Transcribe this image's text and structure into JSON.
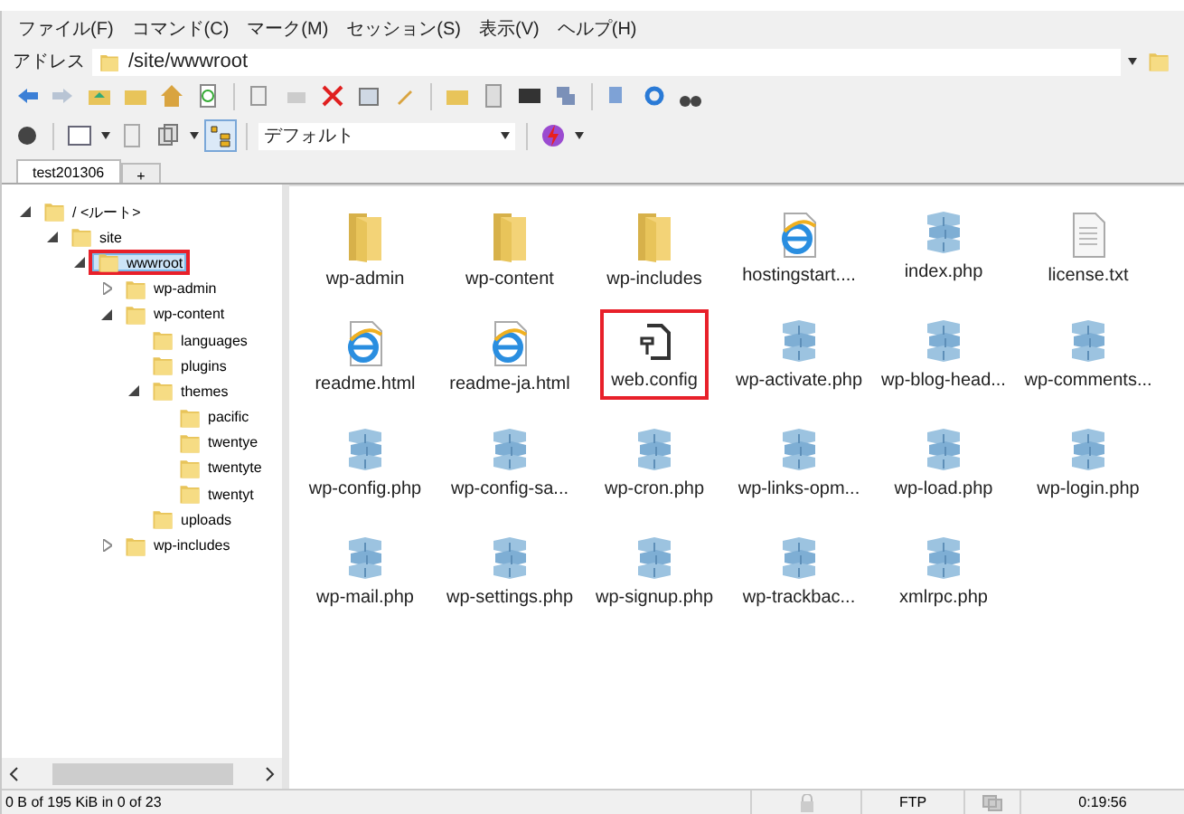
{
  "menu": [
    "ファイル(F)",
    "コマンド(C)",
    "マーク(M)",
    "セッション(S)",
    "表示(V)",
    "ヘルプ(H)"
  ],
  "address": {
    "label": "アドレス",
    "value": "/site/wwwroot"
  },
  "toolbar": {
    "preset": "デフォルト"
  },
  "tabs": [
    {
      "label": "test201306",
      "selected": true
    },
    {
      "label": "+",
      "selected": false
    }
  ],
  "tree": [
    {
      "label": "/ <ルート>",
      "expanded": true,
      "highlighted": false,
      "children": [
        {
          "label": "site",
          "expanded": true,
          "highlighted": false,
          "children": [
            {
              "label": "wwwroot",
              "expanded": true,
              "selected": true,
              "highlighted": true,
              "children": [
                {
                  "label": "wp-admin",
                  "expanded": false,
                  "has_children": true,
                  "highlighted": false
                },
                {
                  "label": "wp-content",
                  "expanded": true,
                  "highlighted": false,
                  "children": [
                    {
                      "label": "languages",
                      "highlighted": false
                    },
                    {
                      "label": "plugins",
                      "highlighted": false
                    },
                    {
                      "label": "themes",
                      "expanded": true,
                      "highlighted": false,
                      "children": [
                        {
                          "label": "pacific",
                          "highlighted": false
                        },
                        {
                          "label": "twentye",
                          "highlighted": false
                        },
                        {
                          "label": "twentyte",
                          "highlighted": false
                        },
                        {
                          "label": "twentyt",
                          "highlighted": false
                        }
                      ]
                    },
                    {
                      "label": "uploads",
                      "highlighted": false
                    }
                  ]
                },
                {
                  "label": "wp-includes",
                  "expanded": false,
                  "has_children": true,
                  "highlighted": false
                }
              ]
            }
          ]
        }
      ]
    }
  ],
  "files": [
    {
      "name": "wp-admin",
      "kind": "folder",
      "highlighted": false
    },
    {
      "name": "wp-content",
      "kind": "folder",
      "highlighted": false
    },
    {
      "name": "wp-includes",
      "kind": "folder",
      "highlighted": false
    },
    {
      "name": "hostingstart....",
      "kind": "web",
      "highlighted": false
    },
    {
      "name": "index.php",
      "kind": "php",
      "highlighted": false
    },
    {
      "name": "license.txt",
      "kind": "text",
      "highlighted": false
    },
    {
      "name": "readme.html",
      "kind": "web",
      "highlighted": false
    },
    {
      "name": "readme-ja.html",
      "kind": "web",
      "highlighted": false
    },
    {
      "name": "web.config",
      "kind": "config",
      "highlighted": true
    },
    {
      "name": "wp-activate.php",
      "kind": "php",
      "highlighted": false
    },
    {
      "name": "wp-blog-head...",
      "kind": "php",
      "highlighted": false
    },
    {
      "name": "wp-comments...",
      "kind": "php",
      "highlighted": false
    },
    {
      "name": "wp-config.php",
      "kind": "php",
      "highlighted": false
    },
    {
      "name": "wp-config-sa...",
      "kind": "php",
      "highlighted": false
    },
    {
      "name": "wp-cron.php",
      "kind": "php",
      "highlighted": false
    },
    {
      "name": "wp-links-opm...",
      "kind": "php",
      "highlighted": false
    },
    {
      "name": "wp-load.php",
      "kind": "php",
      "highlighted": false
    },
    {
      "name": "wp-login.php",
      "kind": "php",
      "highlighted": false
    },
    {
      "name": "wp-mail.php",
      "kind": "php",
      "highlighted": false
    },
    {
      "name": "wp-settings.php",
      "kind": "php",
      "highlighted": false
    },
    {
      "name": "wp-signup.php",
      "kind": "php",
      "highlighted": false
    },
    {
      "name": "wp-trackbac...",
      "kind": "php",
      "highlighted": false
    },
    {
      "name": "xmlrpc.php",
      "kind": "php",
      "highlighted": false
    }
  ],
  "status_bar": {
    "selection": "0 B of 195 KiB in 0 of 23",
    "protocol": "FTP",
    "time": "0:19:56"
  }
}
